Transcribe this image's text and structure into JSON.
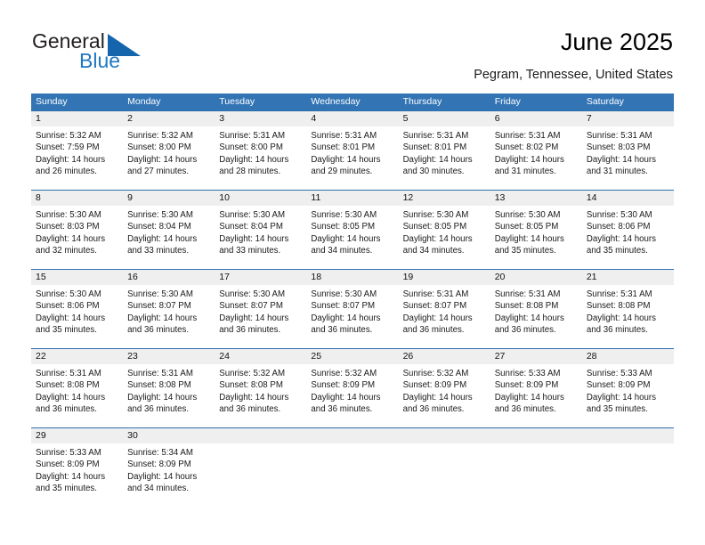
{
  "brand": {
    "name_part1": "General",
    "name_part2": "Blue",
    "triangle_color": "#1565ad",
    "blue_text_color": "#1f78c1"
  },
  "header": {
    "title": "June 2025",
    "subtitle": "Pegram, Tennessee, United States"
  },
  "theme": {
    "header_blue": "#3274b4",
    "separator_blue": "#2f6fae",
    "numbar_gray": "#efefef",
    "text_color": "#1a1a1a"
  },
  "weekdays": [
    "Sunday",
    "Monday",
    "Tuesday",
    "Wednesday",
    "Thursday",
    "Friday",
    "Saturday"
  ],
  "weeks": [
    {
      "days": [
        {
          "num": "1",
          "sunrise": "Sunrise: 5:32 AM",
          "sunset": "Sunset: 7:59 PM",
          "daylight1": "Daylight: 14 hours",
          "daylight2": "and 26 minutes."
        },
        {
          "num": "2",
          "sunrise": "Sunrise: 5:32 AM",
          "sunset": "Sunset: 8:00 PM",
          "daylight1": "Daylight: 14 hours",
          "daylight2": "and 27 minutes."
        },
        {
          "num": "3",
          "sunrise": "Sunrise: 5:31 AM",
          "sunset": "Sunset: 8:00 PM",
          "daylight1": "Daylight: 14 hours",
          "daylight2": "and 28 minutes."
        },
        {
          "num": "4",
          "sunrise": "Sunrise: 5:31 AM",
          "sunset": "Sunset: 8:01 PM",
          "daylight1": "Daylight: 14 hours",
          "daylight2": "and 29 minutes."
        },
        {
          "num": "5",
          "sunrise": "Sunrise: 5:31 AM",
          "sunset": "Sunset: 8:01 PM",
          "daylight1": "Daylight: 14 hours",
          "daylight2": "and 30 minutes."
        },
        {
          "num": "6",
          "sunrise": "Sunrise: 5:31 AM",
          "sunset": "Sunset: 8:02 PM",
          "daylight1": "Daylight: 14 hours",
          "daylight2": "and 31 minutes."
        },
        {
          "num": "7",
          "sunrise": "Sunrise: 5:31 AM",
          "sunset": "Sunset: 8:03 PM",
          "daylight1": "Daylight: 14 hours",
          "daylight2": "and 31 minutes."
        }
      ]
    },
    {
      "days": [
        {
          "num": "8",
          "sunrise": "Sunrise: 5:30 AM",
          "sunset": "Sunset: 8:03 PM",
          "daylight1": "Daylight: 14 hours",
          "daylight2": "and 32 minutes."
        },
        {
          "num": "9",
          "sunrise": "Sunrise: 5:30 AM",
          "sunset": "Sunset: 8:04 PM",
          "daylight1": "Daylight: 14 hours",
          "daylight2": "and 33 minutes."
        },
        {
          "num": "10",
          "sunrise": "Sunrise: 5:30 AM",
          "sunset": "Sunset: 8:04 PM",
          "daylight1": "Daylight: 14 hours",
          "daylight2": "and 33 minutes."
        },
        {
          "num": "11",
          "sunrise": "Sunrise: 5:30 AM",
          "sunset": "Sunset: 8:05 PM",
          "daylight1": "Daylight: 14 hours",
          "daylight2": "and 34 minutes."
        },
        {
          "num": "12",
          "sunrise": "Sunrise: 5:30 AM",
          "sunset": "Sunset: 8:05 PM",
          "daylight1": "Daylight: 14 hours",
          "daylight2": "and 34 minutes."
        },
        {
          "num": "13",
          "sunrise": "Sunrise: 5:30 AM",
          "sunset": "Sunset: 8:05 PM",
          "daylight1": "Daylight: 14 hours",
          "daylight2": "and 35 minutes."
        },
        {
          "num": "14",
          "sunrise": "Sunrise: 5:30 AM",
          "sunset": "Sunset: 8:06 PM",
          "daylight1": "Daylight: 14 hours",
          "daylight2": "and 35 minutes."
        }
      ]
    },
    {
      "days": [
        {
          "num": "15",
          "sunrise": "Sunrise: 5:30 AM",
          "sunset": "Sunset: 8:06 PM",
          "daylight1": "Daylight: 14 hours",
          "daylight2": "and 35 minutes."
        },
        {
          "num": "16",
          "sunrise": "Sunrise: 5:30 AM",
          "sunset": "Sunset: 8:07 PM",
          "daylight1": "Daylight: 14 hours",
          "daylight2": "and 36 minutes."
        },
        {
          "num": "17",
          "sunrise": "Sunrise: 5:30 AM",
          "sunset": "Sunset: 8:07 PM",
          "daylight1": "Daylight: 14 hours",
          "daylight2": "and 36 minutes."
        },
        {
          "num": "18",
          "sunrise": "Sunrise: 5:30 AM",
          "sunset": "Sunset: 8:07 PM",
          "daylight1": "Daylight: 14 hours",
          "daylight2": "and 36 minutes."
        },
        {
          "num": "19",
          "sunrise": "Sunrise: 5:31 AM",
          "sunset": "Sunset: 8:07 PM",
          "daylight1": "Daylight: 14 hours",
          "daylight2": "and 36 minutes."
        },
        {
          "num": "20",
          "sunrise": "Sunrise: 5:31 AM",
          "sunset": "Sunset: 8:08 PM",
          "daylight1": "Daylight: 14 hours",
          "daylight2": "and 36 minutes."
        },
        {
          "num": "21",
          "sunrise": "Sunrise: 5:31 AM",
          "sunset": "Sunset: 8:08 PM",
          "daylight1": "Daylight: 14 hours",
          "daylight2": "and 36 minutes."
        }
      ]
    },
    {
      "days": [
        {
          "num": "22",
          "sunrise": "Sunrise: 5:31 AM",
          "sunset": "Sunset: 8:08 PM",
          "daylight1": "Daylight: 14 hours",
          "daylight2": "and 36 minutes."
        },
        {
          "num": "23",
          "sunrise": "Sunrise: 5:31 AM",
          "sunset": "Sunset: 8:08 PM",
          "daylight1": "Daylight: 14 hours",
          "daylight2": "and 36 minutes."
        },
        {
          "num": "24",
          "sunrise": "Sunrise: 5:32 AM",
          "sunset": "Sunset: 8:08 PM",
          "daylight1": "Daylight: 14 hours",
          "daylight2": "and 36 minutes."
        },
        {
          "num": "25",
          "sunrise": "Sunrise: 5:32 AM",
          "sunset": "Sunset: 8:09 PM",
          "daylight1": "Daylight: 14 hours",
          "daylight2": "and 36 minutes."
        },
        {
          "num": "26",
          "sunrise": "Sunrise: 5:32 AM",
          "sunset": "Sunset: 8:09 PM",
          "daylight1": "Daylight: 14 hours",
          "daylight2": "and 36 minutes."
        },
        {
          "num": "27",
          "sunrise": "Sunrise: 5:33 AM",
          "sunset": "Sunset: 8:09 PM",
          "daylight1": "Daylight: 14 hours",
          "daylight2": "and 36 minutes."
        },
        {
          "num": "28",
          "sunrise": "Sunrise: 5:33 AM",
          "sunset": "Sunset: 8:09 PM",
          "daylight1": "Daylight: 14 hours",
          "daylight2": "and 35 minutes."
        }
      ]
    },
    {
      "days": [
        {
          "num": "29",
          "sunrise": "Sunrise: 5:33 AM",
          "sunset": "Sunset: 8:09 PM",
          "daylight1": "Daylight: 14 hours",
          "daylight2": "and 35 minutes."
        },
        {
          "num": "30",
          "sunrise": "Sunrise: 5:34 AM",
          "sunset": "Sunset: 8:09 PM",
          "daylight1": "Daylight: 14 hours",
          "daylight2": "and 34 minutes."
        },
        {
          "num": "",
          "sunrise": "",
          "sunset": "",
          "daylight1": "",
          "daylight2": ""
        },
        {
          "num": "",
          "sunrise": "",
          "sunset": "",
          "daylight1": "",
          "daylight2": ""
        },
        {
          "num": "",
          "sunrise": "",
          "sunset": "",
          "daylight1": "",
          "daylight2": ""
        },
        {
          "num": "",
          "sunrise": "",
          "sunset": "",
          "daylight1": "",
          "daylight2": ""
        },
        {
          "num": "",
          "sunrise": "",
          "sunset": "",
          "daylight1": "",
          "daylight2": ""
        }
      ]
    }
  ]
}
